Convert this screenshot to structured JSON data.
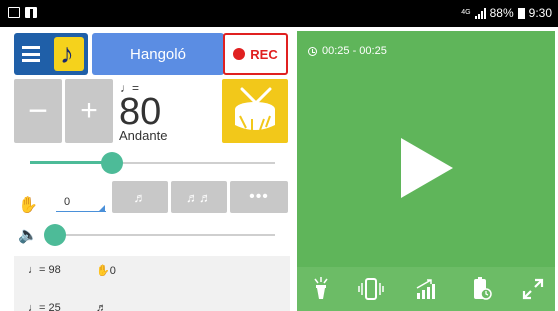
{
  "statusbar": {
    "network": "4G",
    "battery": "88%",
    "time": "9:30"
  },
  "toolbar": {
    "tuner_label": "Hangoló",
    "rec_label": "REC"
  },
  "tempo": {
    "note_prefix": "♩=",
    "bpm": "80",
    "name": "Andante",
    "slider_fraction": 0.34
  },
  "beats": {
    "value": "0",
    "subdivision_1": "♬",
    "subdivision_2": "♬♬",
    "more": "•••"
  },
  "volume": {
    "level_fraction": 0.02
  },
  "presets": [
    {
      "note": "♩= 98",
      "beats": "0"
    },
    {
      "note": "♩= 25",
      "beats": ""
    }
  ],
  "player": {
    "time_range": "00:25 - 00:25"
  },
  "icons": {
    "menu": "hamburger-icon",
    "logo": "app-logo-icon",
    "drum": "drum-icon",
    "clap": "clap-icon",
    "volume": "volume-icon",
    "clock": "clock-icon",
    "play": "play-icon",
    "flashlight": "flashlight-icon",
    "vibrate": "vibrate-icon",
    "speed": "speed-ramp-icon",
    "battery": "battery-icon",
    "fullscreen": "fullscreen-icon"
  },
  "colors": {
    "menu_blue": "#1f5fa8",
    "tuner_blue": "#5b8de3",
    "rec_red": "#e02020",
    "accent_green": "#4dbb98",
    "player_green": "#5fb55a",
    "drum_yellow": "#f2c81a"
  }
}
